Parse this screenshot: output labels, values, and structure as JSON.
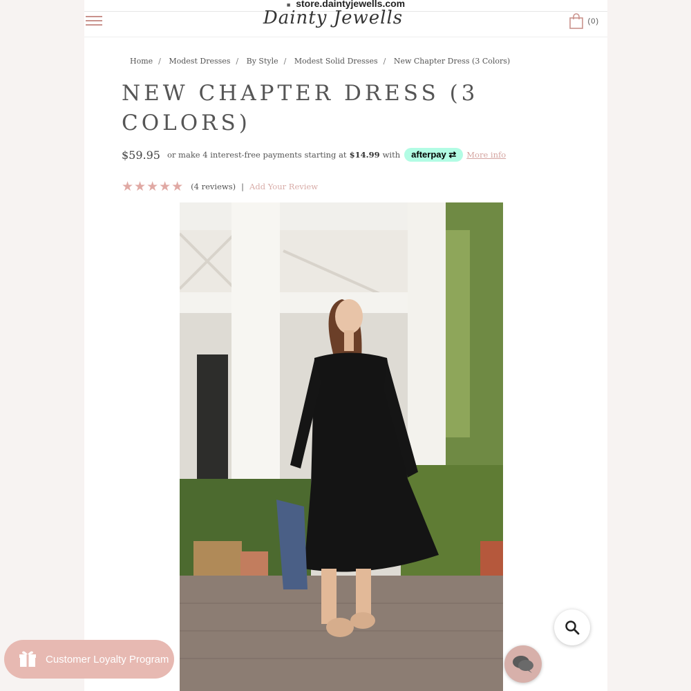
{
  "browser": {
    "url": "store.daintyjewells.com"
  },
  "header": {
    "logo_text": "Dainty Jewells",
    "cart_count": "(0)"
  },
  "breadcrumb": {
    "items": [
      "Home",
      "Modest Dresses",
      "By Style",
      "Modest Solid Dresses",
      "New Chapter Dress (3 Colors)"
    ],
    "separator": "/"
  },
  "product": {
    "title": "NEW CHAPTER DRESS (3 COLORS)",
    "price": "$59.95",
    "installment_text": "or make 4 interest-free payments starting at",
    "installment_amount": "$14.99",
    "installment_with": "with",
    "afterpay_label": "afterpay",
    "more_info": "More info",
    "stars": "★★★★★",
    "rating": 5,
    "reviews_text": "(4 reviews)",
    "review_separator": "|",
    "add_review": "Add Your Review"
  },
  "loyalty": {
    "label": "Customer Loyalty Program"
  },
  "colors": {
    "accent": "#e7b9b2",
    "star": "#e0a9a4",
    "afterpay": "#b2fce4"
  }
}
